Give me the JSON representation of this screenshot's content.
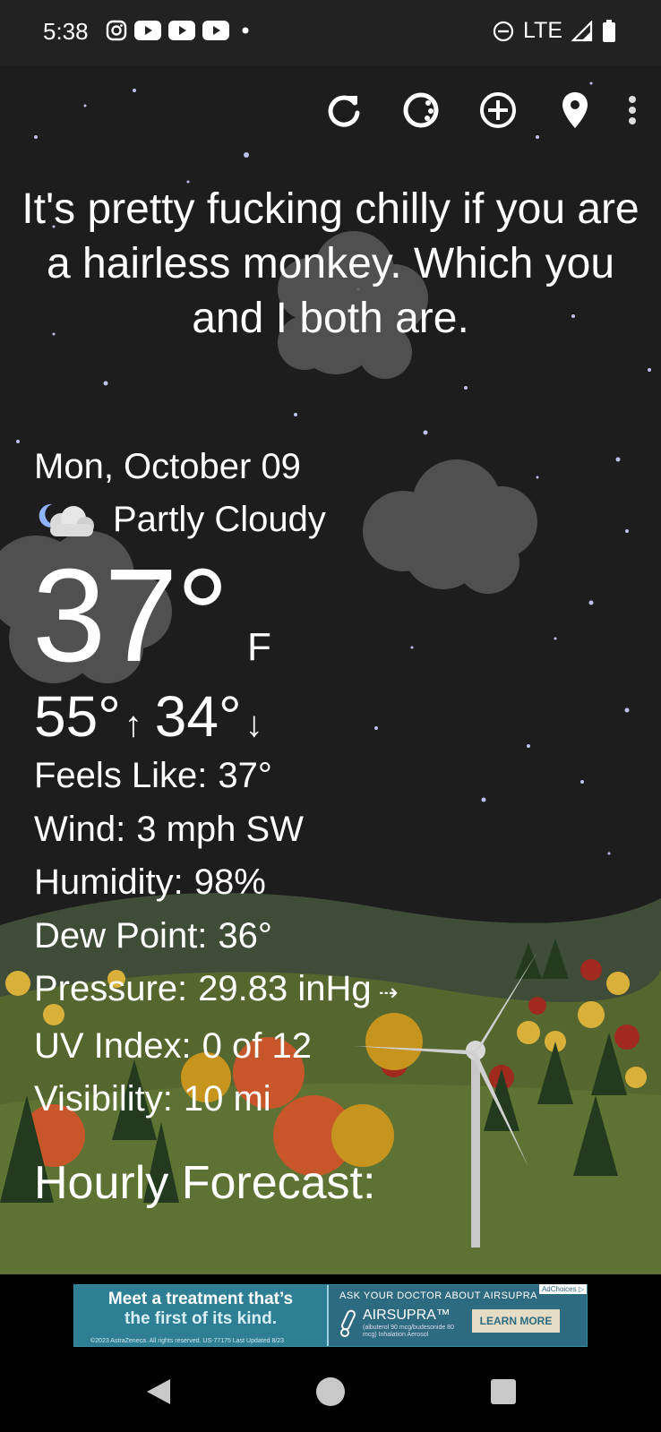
{
  "status_bar": {
    "time": "5:38",
    "network": "LTE",
    "left_icons": [
      "instagram-icon",
      "youtube-icon",
      "youtube-icon",
      "youtube-icon",
      "dot-icon"
    ],
    "right_icons": [
      "do-not-disturb-icon",
      "signal-icon",
      "battery-icon"
    ]
  },
  "toolbar": {
    "buttons": [
      "refresh-icon",
      "theme-icon",
      "add-location-icon",
      "location-pin-icon",
      "overflow-menu-icon"
    ]
  },
  "quote": "It's pretty fucking chilly if you are a hairless monkey. Which you and I both are.",
  "weather": {
    "date": "Mon, October 09",
    "condition": "Partly Cloudy",
    "condition_icon": "partly-cloudy-night-icon",
    "temperature": "37°",
    "unit": "F",
    "high": "55°",
    "low": "34°",
    "high_arrow": "↑",
    "low_arrow": "↓"
  },
  "details": [
    {
      "label": "Feels Like:",
      "value": "37°"
    },
    {
      "label": "Wind:",
      "value": "3 mph SW"
    },
    {
      "label": "Humidity:",
      "value": "98%"
    },
    {
      "label": "Dew Point:",
      "value": "36°"
    },
    {
      "label": "Pressure:",
      "value": "29.83 inHg",
      "trend": "⇢"
    },
    {
      "label": "UV Index:",
      "value": "0 of 12"
    },
    {
      "label": "Visibility:",
      "value": "10 mi"
    }
  ],
  "hourly_heading": "Hourly Forecast:",
  "ad": {
    "headline_1": "Meet a treatment that’s",
    "headline_2": "the first of its kind.",
    "fine_print": "©2023 AstraZeneca. All rights reserved. US-77175 Last Updated 8/23",
    "ask": "ASK YOUR DOCTOR ABOUT AIRSUPRA",
    "brand": "AIRSUPRA™",
    "brand_fine": "(albuterol 90 mcg/budesonide 80 mcg) Inhalation Aerosol",
    "cta": "LEARN MORE",
    "choices": "AdChoices ▷"
  },
  "colors": {
    "status_bar": "#222222",
    "sky": "#1d1d1d",
    "hill": "#4b5a36",
    "ad_bg": "#2f7f94"
  }
}
